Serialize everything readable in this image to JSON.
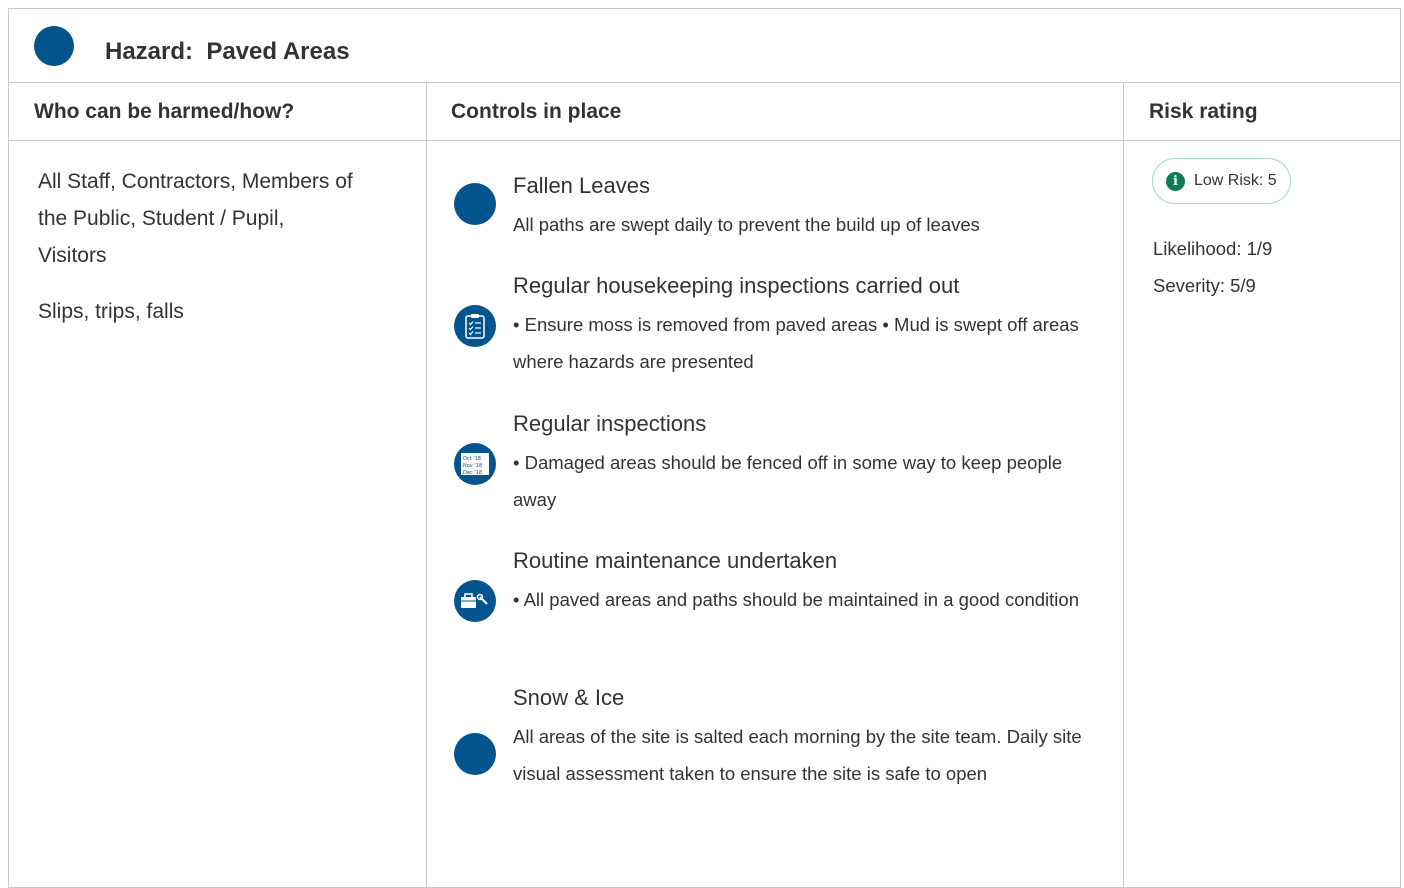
{
  "hazard": {
    "label": "Hazard:",
    "name": "Paved Areas",
    "title": "Hazard:  Paved Areas"
  },
  "columns": {
    "who": "Who can be harmed/how?",
    "controls": "Controls in place",
    "risk": "Risk rating"
  },
  "who": {
    "people": "All Staff, Contractors, Members of the Public, Student / Pupil, Visitors",
    "how": "Slips, trips, falls"
  },
  "controls": [
    {
      "icon": "dot-icon",
      "title": "Fallen Leaves",
      "description": "All paths are swept daily to prevent the build up of leaves"
    },
    {
      "icon": "clipboard-checklist-icon",
      "title": "Regular housekeeping inspections carried out",
      "description": "• Ensure moss is removed from paved areas • Mud is swept off areas where hazards are presented"
    },
    {
      "icon": "calendar-icon",
      "title": "Regular inspections",
      "description": "• Damaged areas should be fenced off in some way to keep people away",
      "calendar_text": [
        "Oct '18",
        "Nov '18",
        "Dec '18"
      ]
    },
    {
      "icon": "toolbox-wrench-icon",
      "title": "Routine maintenance undertaken",
      "description": "• All paved areas and paths should be maintained in a good condition"
    },
    {
      "icon": "dot-icon",
      "title": "Snow & Ice",
      "description": "All areas of the site is salted each morning by the site team. Daily site visual assessment taken to ensure the site is safe to open"
    }
  ],
  "risk": {
    "badge": "Low Risk: 5",
    "likelihood": "Likelihood: 1/9",
    "severity": "Severity: 5/9"
  },
  "colors": {
    "icon_blue": "#04548e",
    "border": "#c9c9c9",
    "badge_border": "#a5dcc6",
    "info_green": "#0e7c58"
  }
}
